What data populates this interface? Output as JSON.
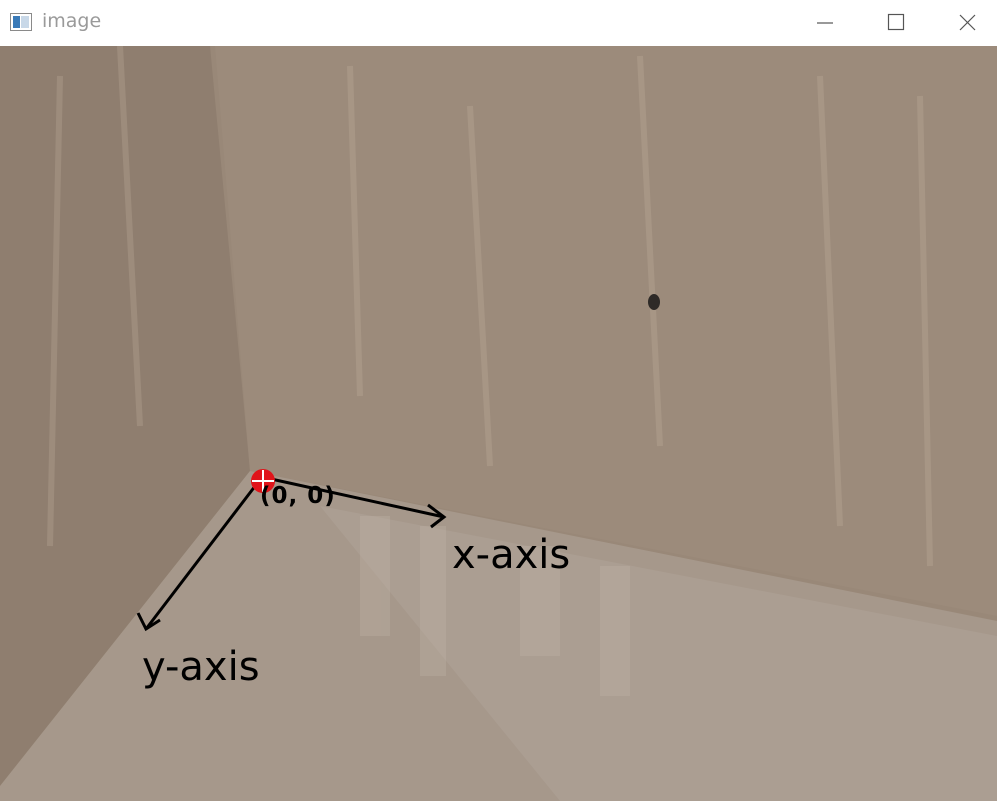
{
  "window": {
    "title": "image",
    "icon": "image-window-icon",
    "controls": [
      "minimize-icon",
      "maximize-icon",
      "close-icon"
    ]
  },
  "annotations": {
    "origin_label": "(0, 0)",
    "x_axis_label": "x-axis",
    "y_axis_label": "y-axis",
    "axis_color": "#000000",
    "origin_marker_color": "#e0141a"
  },
  "colors": {
    "wall": "#9a8878",
    "floor": "#a99b8f"
  }
}
